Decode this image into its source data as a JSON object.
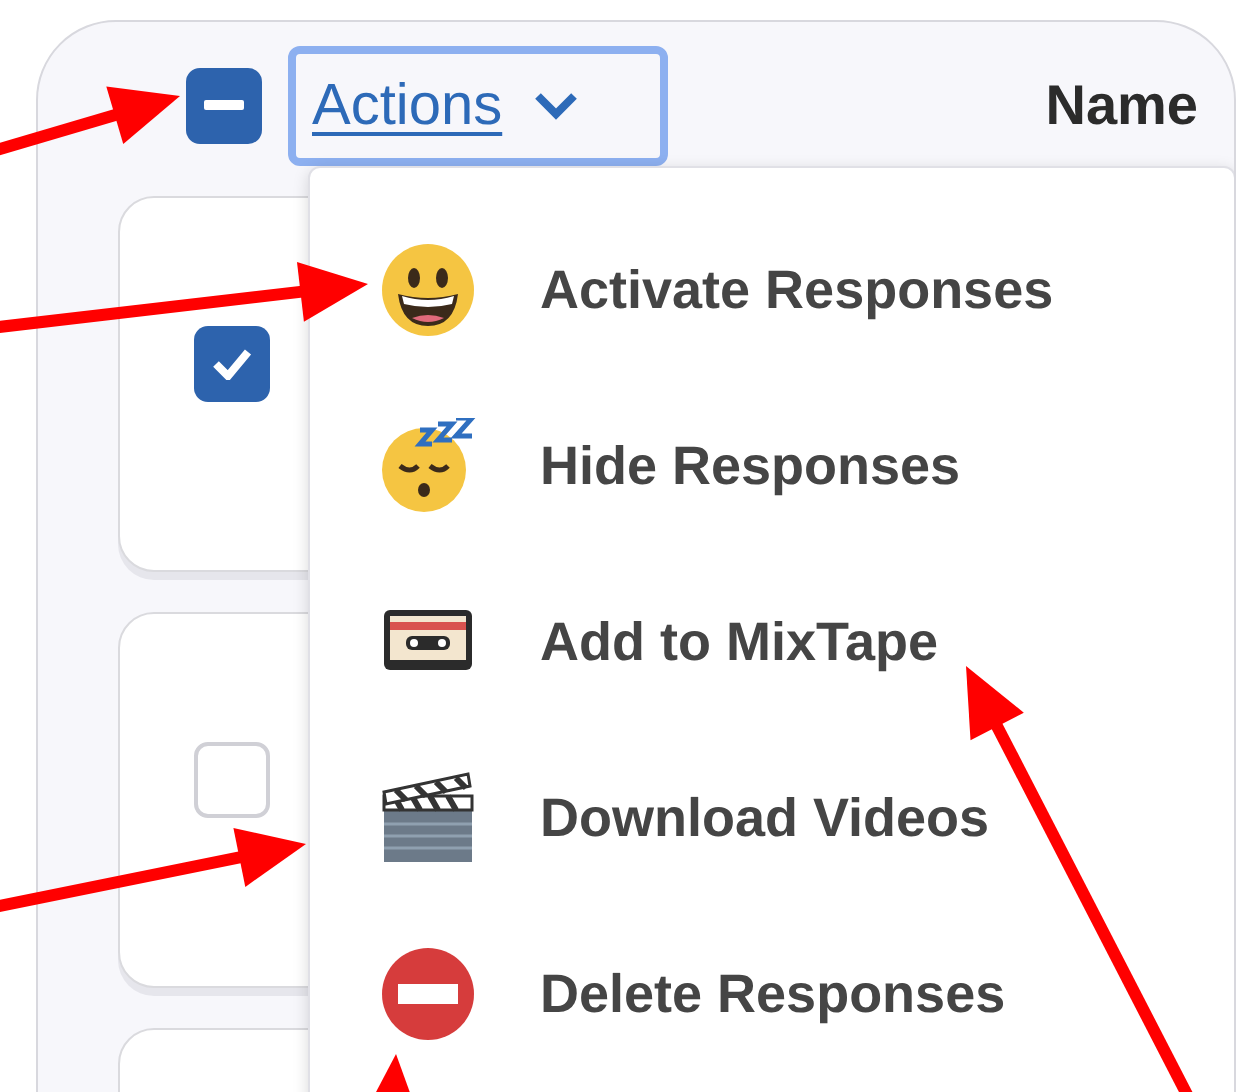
{
  "header": {
    "select_all": {
      "indeterminate": true
    },
    "actions_button": {
      "label": "Actions",
      "focused": true
    },
    "column_heading": "Name"
  },
  "rows": [
    {
      "kind": "selectable",
      "checked": true
    },
    {
      "kind": "selectable",
      "checked": false
    },
    {
      "kind": "partial"
    }
  ],
  "menu": {
    "items": [
      {
        "label": "Activate Responses",
        "kind": "grinning"
      },
      {
        "label": "Hide Responses",
        "kind": "sleepy"
      },
      {
        "label": "Add to MixTape",
        "kind": "cassette"
      },
      {
        "label": "Download Videos",
        "kind": "clapper"
      },
      {
        "label": "Delete Responses",
        "kind": "no-entry"
      }
    ]
  }
}
